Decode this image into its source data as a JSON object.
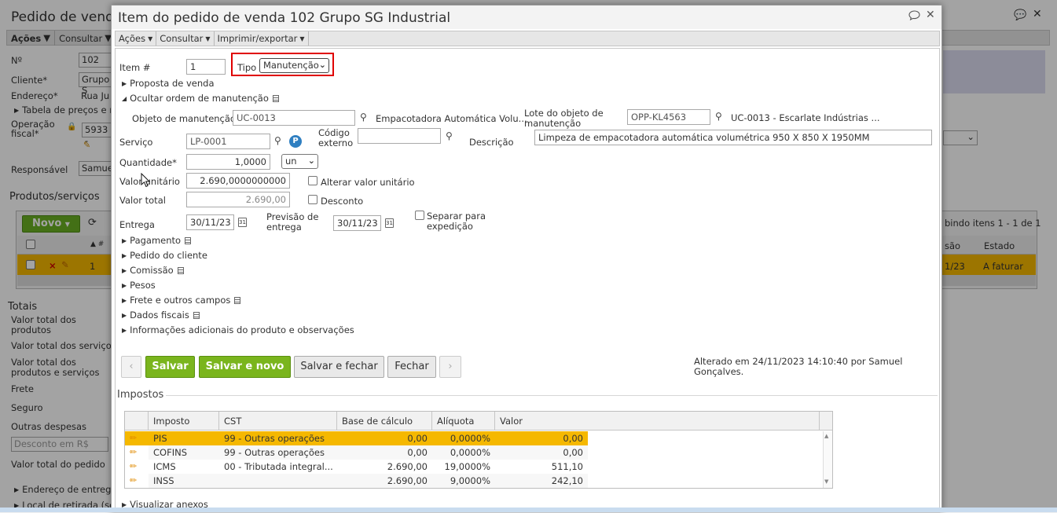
{
  "background": {
    "title": "Pedido de venda",
    "menu": [
      "Ações",
      "Consultar"
    ],
    "labels": {
      "numero": "Nº",
      "cliente": "Cliente*",
      "endereco": "Endereço*",
      "tabela": "Tabela de preços e re",
      "operacao": "Operação fiscal*",
      "responsavel": "Responsável",
      "produtos": "Produtos/serviços",
      "totais": "Totais",
      "valor_produtos": "Valor total dos produtos",
      "valor_servicos": "Valor total dos serviços",
      "valor_prod_serv": "Valor total dos produtos e serviços",
      "frete": "Frete",
      "seguro": "Seguro",
      "outras": "Outras despesas",
      "desconto": "Desconto em R$",
      "valor_pedido": "Valor total do pedido",
      "end_entrega": "Endereço de entrega",
      "local_retirada": "Local de retirada (se"
    },
    "values": {
      "numero": "102",
      "cliente": "Grupo S",
      "endereco": "Rua Ju",
      "operacao": "5933 -",
      "responsavel": "Samuel"
    },
    "novo_label": "Novo",
    "exibindo": "bindo itens 1 - 1 de 1",
    "cols": [
      "são",
      "Estado"
    ],
    "row": {
      "num": "1",
      "data": "1/23",
      "estado": "A faturar"
    }
  },
  "modal": {
    "title": "Item do pedido de venda 102 Grupo SG Industrial",
    "toolbar": [
      "Ações",
      "Consultar",
      "Imprimir/exportar"
    ],
    "item_label": "Item #",
    "item_value": "1",
    "tipo_label": "Tipo",
    "tipo_value": "Manutenção",
    "proposta": "Proposta de venda",
    "ocultar_ordem": "Ocultar ordem de manutenção",
    "objeto_label": "Objeto de manutenção",
    "objeto_value": "UC-0013",
    "objeto_desc": "Empacotadora Automática Volu...",
    "lote_label": "Lote do objeto de manutenção",
    "lote_value": "OPP-KL4563",
    "lote_desc": "UC-0013 - Escarlate Indústrias ...",
    "servico_label": "Serviço",
    "servico_value": "LP-0001",
    "codigo_label": "Código externo",
    "codigo_value": "",
    "descricao_label": "Descrição",
    "descricao_value": "Limpeza de empacotadora automática volumétrica 950 X 850 X 1950MM",
    "quantidade_label": "Quantidade*",
    "quantidade_value": "1,0000",
    "unidade_value": "un",
    "valor_unitario_label": "Valor unitário",
    "valor_unitario_value": "2.690,0000000000",
    "alterar_label": "Alterar valor unitário",
    "valor_total_label": "Valor total",
    "valor_total_value": "2.690,00",
    "desconto_label": "Desconto",
    "entrega_label": "Entrega",
    "entrega_value": "30/11/23",
    "previsao_label": "Previsão de entrega",
    "previsao_value": "30/11/23",
    "separar_label": "Separar para expedição",
    "sections": [
      "Pagamento",
      "Pedido do cliente",
      "Comissão",
      "Pesos",
      "Frete e outros campos",
      "Dados fiscais",
      "Informações adicionais do produto e observações"
    ],
    "buttons": {
      "salvar": "Salvar",
      "salvar_novo": "Salvar e novo",
      "salvar_fechar": "Salvar e fechar",
      "fechar": "Fechar"
    },
    "alterado": "Alterado em 24/11/2023 14:10:40 por Samuel Gonçalves.",
    "impostos_title": "Impostos",
    "visualizar_anexos": "Visualizar anexos",
    "tax_headers": [
      "Imposto",
      "CST",
      "Base de cálculo",
      "Alíquota",
      "Valor"
    ],
    "tax_rows": [
      {
        "imposto": "PIS",
        "cst": "99 - Outras operações",
        "base": "0,00",
        "aliquota": "0,0000%",
        "valor": "0,00"
      },
      {
        "imposto": "COFINS",
        "cst": "99 - Outras operações",
        "base": "0,00",
        "aliquota": "0,0000%",
        "valor": "0,00"
      },
      {
        "imposto": "ICMS",
        "cst": "00 - Tributada integral...",
        "base": "2.690,00",
        "aliquota": "19,0000%",
        "valor": "511,10"
      },
      {
        "imposto": "INSS",
        "cst": "",
        "base": "2.690,00",
        "aliquota": "9,0000%",
        "valor": "242,10"
      }
    ],
    "colors": {
      "highlight": "#f5b800",
      "green": "#7ab51d",
      "focus_red": "#e00000"
    }
  }
}
